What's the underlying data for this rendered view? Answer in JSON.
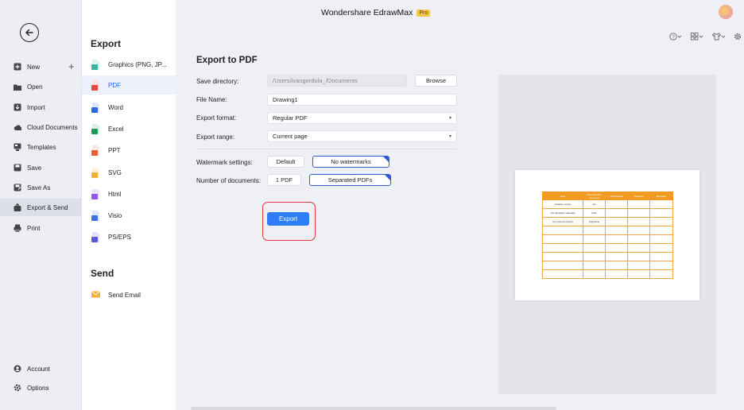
{
  "app": {
    "title": "Wondershare EdrawMax",
    "badge": "Pro"
  },
  "sidebar": {
    "items": [
      {
        "label": "New",
        "icon": "new-icon"
      },
      {
        "label": "Open",
        "icon": "folder-icon"
      },
      {
        "label": "Import",
        "icon": "import-icon"
      },
      {
        "label": "Cloud Documents",
        "icon": "cloud-icon"
      },
      {
        "label": "Templates",
        "icon": "templates-icon"
      },
      {
        "label": "Save",
        "icon": "save-icon"
      },
      {
        "label": "Save As",
        "icon": "save-as-icon"
      },
      {
        "label": "Export & Send",
        "icon": "export-icon"
      },
      {
        "label": "Print",
        "icon": "print-icon"
      }
    ],
    "bottom": [
      {
        "label": "Account",
        "icon": "account-icon"
      },
      {
        "label": "Options",
        "icon": "gear-icon"
      }
    ]
  },
  "formats": {
    "export_heading": "Export",
    "send_heading": "Send",
    "items": [
      {
        "label": "Graphics (PNG, JP...",
        "color": "#35b7a4"
      },
      {
        "label": "PDF",
        "color": "#e64545"
      },
      {
        "label": "Word",
        "color": "#2d6ae3"
      },
      {
        "label": "Excel",
        "color": "#1f9a55"
      },
      {
        "label": "PPT",
        "color": "#e8603a"
      },
      {
        "label": "SVG",
        "color": "#f2b13b"
      },
      {
        "label": "Html",
        "color": "#8c5ae6"
      },
      {
        "label": "Visio",
        "color": "#3c6fe0"
      },
      {
        "label": "PS/EPS",
        "color": "#5a57d8"
      }
    ],
    "send_items": [
      {
        "label": "Send Email",
        "color": "#f2b13b"
      }
    ]
  },
  "form": {
    "title": "Export to PDF",
    "save_dir_label": "Save directory:",
    "save_dir_value": "/Users/ivangordola_/Documents",
    "browse": "Browse",
    "file_name_label": "File Name:",
    "file_name_value": "Drawing1",
    "format_label": "Export format:",
    "format_value": "Regular PDF",
    "range_label": "Export range:",
    "range_value": "Current page",
    "watermark_label": "Watermark settings:",
    "watermark_default": "Default",
    "watermark_none": "No watermarks",
    "docs_label": "Number of documents:",
    "docs_one": "1 PDF",
    "docs_separated": "Separated PDFs",
    "export_button": "Export"
  },
  "preview": {
    "headers": [
      "Task",
      "Team Member Assigned",
      "Task Started",
      "Deadline",
      "Remarks"
    ],
    "rows": [
      [
        "Creative survey",
        "Jon",
        "",
        "",
        ""
      ],
      [
        "Ad campaign materials",
        "Kate",
        "",
        "",
        ""
      ],
      [
        "On-ground projects",
        "Augustine",
        "",
        "",
        ""
      ],
      [
        "",
        "",
        "",
        "",
        ""
      ],
      [
        "",
        "",
        "",
        "",
        ""
      ],
      [
        "",
        "",
        "",
        "",
        ""
      ],
      [
        "",
        "",
        "",
        "",
        ""
      ],
      [
        "",
        "",
        "",
        "",
        ""
      ],
      [
        "",
        "",
        "",
        "",
        ""
      ]
    ]
  }
}
